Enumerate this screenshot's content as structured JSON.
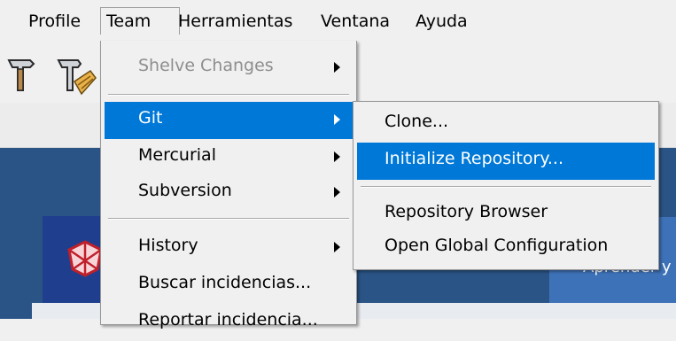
{
  "menubar": {
    "items": [
      {
        "label": "Profile"
      },
      {
        "label": "Team"
      },
      {
        "label": "Herramientas"
      },
      {
        "label": "Ventana"
      },
      {
        "label": "Ayuda"
      }
    ]
  },
  "toolbar": {
    "icons": [
      "hammer-icon",
      "build-broom-icon"
    ]
  },
  "team_menu": {
    "items": [
      {
        "label": "Shelve Changes",
        "disabled": true,
        "submenu": true
      },
      {
        "label": "Git",
        "highlighted": true,
        "submenu": true
      },
      {
        "label": "Mercurial",
        "submenu": true
      },
      {
        "label": "Subversion",
        "submenu": true
      },
      {
        "label": "History",
        "submenu": true
      },
      {
        "label": "Buscar incidencias..."
      },
      {
        "label": "Reportar incidencia..."
      }
    ]
  },
  "git_menu": {
    "items": [
      {
        "label": "Clone..."
      },
      {
        "label": "Initialize Repository...",
        "highlighted": true
      },
      {
        "label": "Repository Browser"
      },
      {
        "label": "Open Global Configuration"
      }
    ]
  },
  "background": {
    "right_text": "Aprender y",
    "logo": "netbeans-logo-icon"
  },
  "colors": {
    "highlight": "#0078d7",
    "menu_bg": "#f0f0f0",
    "content_bg": "#2b5486"
  }
}
